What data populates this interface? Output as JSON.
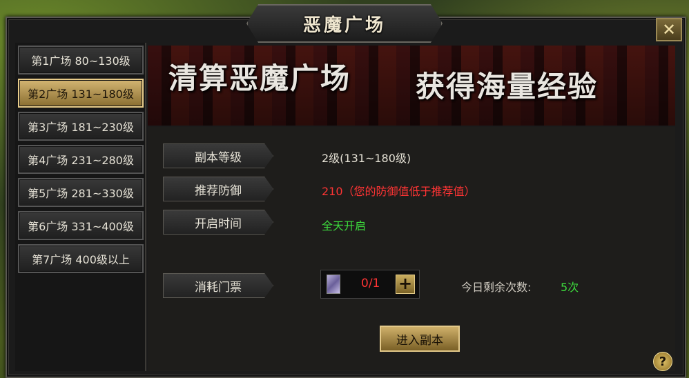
{
  "window": {
    "title": "恶魔广场",
    "close_label": "✕"
  },
  "sidebar": {
    "items": [
      {
        "label": "第1广场 80~130级",
        "active": false
      },
      {
        "label": "第2广场 131~180级",
        "active": true
      },
      {
        "label": "第3广场 181~230级",
        "active": false
      },
      {
        "label": "第4广场 231~280级",
        "active": false
      },
      {
        "label": "第5广场 281~330级",
        "active": false
      },
      {
        "label": "第6广场 331~400级",
        "active": false
      },
      {
        "label": "第7广场 400级以上",
        "active": false
      }
    ]
  },
  "banner": {
    "left_text": "清算恶魔广场",
    "right_text": "获得海量经验"
  },
  "info": {
    "level_label": "副本等级",
    "level_value": "2级(131~180级)",
    "defense_label": "推荐防御",
    "defense_value": "210（您的防御值低于推荐值）",
    "time_label": "开启时间",
    "time_value": "全天开启"
  },
  "ticket": {
    "label": "消耗门票",
    "count": "0/1",
    "plus_label": "+",
    "remain_label": "今日剩余次数:",
    "remain_value": "5次"
  },
  "actions": {
    "enter_label": "进入副本",
    "help_label": "?"
  },
  "colors": {
    "defense_warning": "#ff3434",
    "open_green": "#3ddc3d",
    "level_text": "#e6e2d6"
  }
}
